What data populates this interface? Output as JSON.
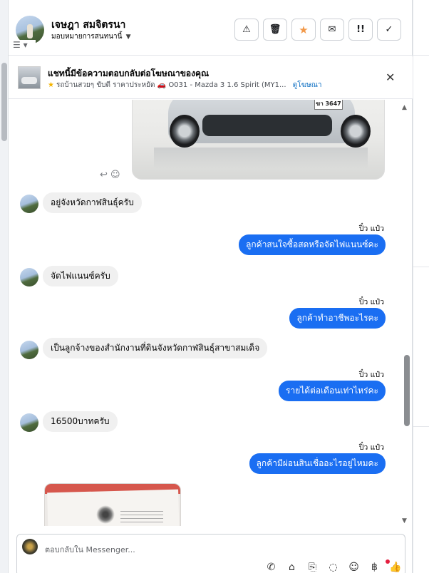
{
  "header": {
    "contact_name": "เจษฎา สมจิตรนา",
    "assign_label": "มอบหมายการสนทนานี้",
    "action_icons": [
      "warning-icon",
      "trash-icon",
      "star-icon",
      "envelope-icon",
      "exclamation-icon",
      "check-icon"
    ]
  },
  "ad": {
    "title": "แชทนี้มีข้อความตอบกลับต่อโฆษณาของคุณ",
    "subtitle": "รถบ้านสวยๆ ขับดี ราคาประหยัด 🚗 O031 - Mazda 3 1.6 Spirit (MY1...",
    "link": "ดูโฆษณา"
  },
  "car_photo": {
    "plate": "ฆา 3647"
  },
  "messages": [
    {
      "dir": "in",
      "text": "อยู่จังหวัดกาฬสินธุ์ครับ"
    },
    {
      "dir": "out",
      "sender": "ปิ๋ว แป๋ว",
      "text": "ลูกค้าสนใจซื้อสดหรือจัดไฟแนนซ์คะ"
    },
    {
      "dir": "in",
      "text": "จัดไฟแนนซ์ครับ"
    },
    {
      "dir": "out",
      "sender": "ปิ๋ว แป๋ว",
      "text": "ลูกค้าทำอาชีพอะไรคะ"
    },
    {
      "dir": "in",
      "text": "เป็นลูกจ้างของสำนักงานที่ดินจังหวัดกาฬสินธุ์สาขาสมเด็จ"
    },
    {
      "dir": "out",
      "sender": "ปิ๋ว แป๋ว",
      "text": "รายได้ต่อเดือนเท่าไหร่คะ"
    },
    {
      "dir": "in",
      "text": "16500บาทครับ"
    },
    {
      "dir": "out",
      "sender": "ปิ๋ว แป๋ว",
      "text": "ลูกค้ามีผ่อนสินเชื่ออะไรอยู่ไหมคะ"
    }
  ],
  "composer": {
    "placeholder": "ตอบกลับใน Messenger...",
    "tool_icons": [
      "call-add-icon",
      "bag-icon",
      "paperclip-icon",
      "chat-bubble-icon",
      "emoji-icon",
      "baht-icon",
      "thumbs-up-icon"
    ]
  },
  "colors": {
    "accent": "#1a6ef2",
    "incoming_bubble": "#f0f0f0",
    "star": "#f2994a"
  }
}
